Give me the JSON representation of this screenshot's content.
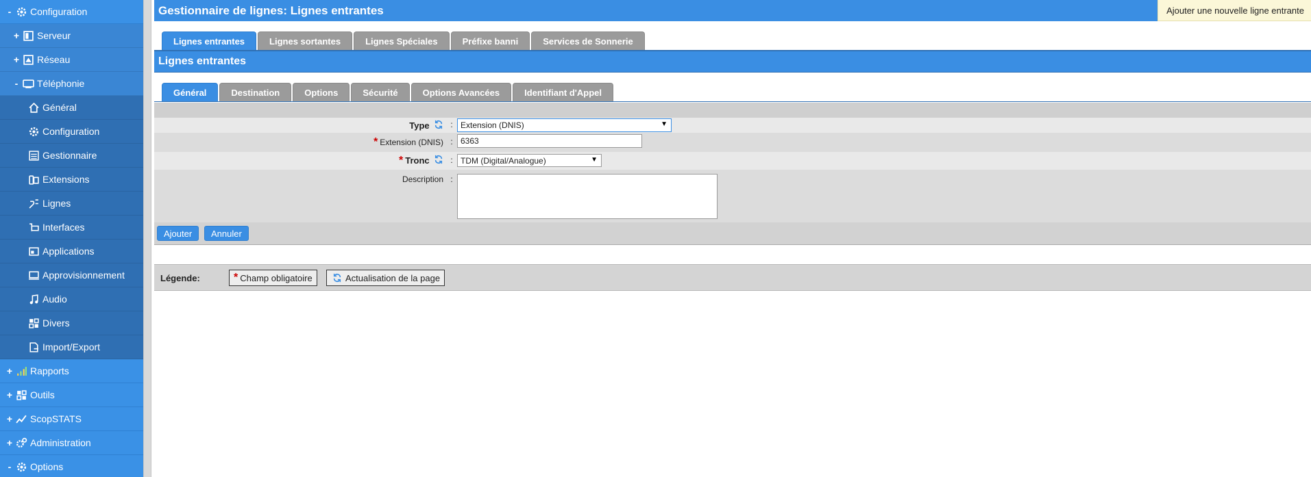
{
  "sidebar": {
    "items": [
      {
        "label": "Configuration",
        "toggle": "-",
        "icon": "gear-icon"
      },
      {
        "label": "Serveur",
        "toggle": "+",
        "icon": "server-icon"
      },
      {
        "label": "Réseau",
        "toggle": "+",
        "icon": "network-icon"
      },
      {
        "label": "Téléphonie",
        "toggle": "-",
        "icon": "telephony-icon"
      },
      {
        "label": "Général",
        "icon": "home-icon"
      },
      {
        "label": "Configuration",
        "icon": "gear-icon"
      },
      {
        "label": "Gestionnaire",
        "icon": "list-icon"
      },
      {
        "label": "Extensions",
        "icon": "phone-icon"
      },
      {
        "label": "Lignes",
        "icon": "lines-icon"
      },
      {
        "label": "Interfaces",
        "icon": "interfaces-icon"
      },
      {
        "label": "Applications",
        "icon": "applications-icon"
      },
      {
        "label": "Approvisionnement",
        "icon": "provisioning-icon"
      },
      {
        "label": "Audio",
        "icon": "music-note-icon"
      },
      {
        "label": "Divers",
        "icon": "grid-icon"
      },
      {
        "label": "Import/Export",
        "icon": "file-export-icon"
      },
      {
        "label": "Rapports",
        "toggle": "+",
        "icon": "bar-chart-icon"
      },
      {
        "label": "Outils",
        "toggle": "+",
        "icon": "tools-icon"
      },
      {
        "label": "ScopSTATS",
        "toggle": "+",
        "icon": "stats-icon"
      },
      {
        "label": "Administration",
        "toggle": "+",
        "icon": "admin-icon"
      },
      {
        "label": "Options",
        "toggle": "-",
        "icon": "gear-icon"
      }
    ]
  },
  "header": {
    "title": "Gestionnaire de lignes:  Lignes entrantes",
    "add_button": "Ajouter une nouvelle ligne entrante"
  },
  "top_tabs": [
    "Lignes entrantes",
    "Lignes sortantes",
    "Lignes Spéciales",
    "Préfixe banni",
    "Services de Sonnerie"
  ],
  "section_title": "Lignes entrantes",
  "sub_tabs": [
    "Général",
    "Destination",
    "Options",
    "Sécurité",
    "Options Avancées",
    "Identifiant d'Appel"
  ],
  "form": {
    "type_label": "Type",
    "type_value": "Extension (DNIS)",
    "extension_label": "Extension (DNIS)",
    "extension_value": "6363",
    "tronc_label": "Tronc",
    "tronc_value": "TDM (Digital/Analogue)",
    "description_label": "Description",
    "description_value": "",
    "colon": ":",
    "required_mark": "*"
  },
  "actions": {
    "add": "Ajouter",
    "cancel": "Annuler"
  },
  "legend": {
    "title": "Légende:",
    "required": "Champ obligatoire",
    "refresh": "Actualisation de la page"
  },
  "colors": {
    "accent": "#3a8ee3",
    "sidebar": "#3a91e6",
    "required": "#cc0000",
    "inactive_tab": "#9b9b9b"
  }
}
